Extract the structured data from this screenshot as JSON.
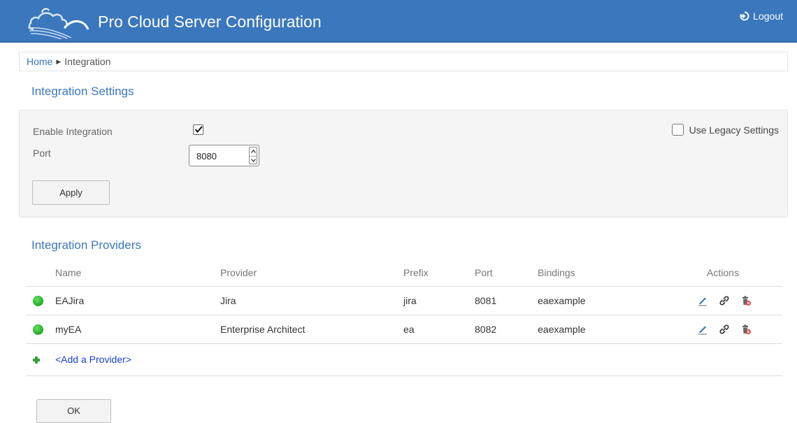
{
  "header": {
    "title": "Pro Cloud Server Configuration",
    "logout_label": "Logout"
  },
  "breadcrumb": {
    "home": "Home",
    "current": "Integration"
  },
  "settings": {
    "title": "Integration Settings",
    "enable_label": "Enable Integration",
    "enable_checked": true,
    "port_label": "Port",
    "port_value": "8080",
    "legacy_label": "Use Legacy Settings",
    "legacy_checked": false,
    "apply_label": "Apply"
  },
  "providers": {
    "title": "Integration Providers",
    "columns": [
      "Name",
      "Provider",
      "Prefix",
      "Port",
      "Bindings",
      "Actions"
    ],
    "rows": [
      {
        "status": "running",
        "name": "EAJira",
        "provider": "Jira",
        "prefix": "jira",
        "port": "8081",
        "bindings": "eaexample"
      },
      {
        "status": "running",
        "name": "myEA",
        "provider": "Enterprise Architect",
        "prefix": "ea",
        "port": "8082",
        "bindings": "eaexample"
      }
    ],
    "add_label": "<Add a Provider>",
    "action_icons": [
      "edit-icon",
      "link-icon",
      "delete-icon"
    ]
  },
  "footer": {
    "ok_label": "OK"
  },
  "colors": {
    "header_bg": "#3a77bd",
    "accent": "#3a77bd",
    "status_ok": "#2db52d",
    "link": "#1a3fd6"
  }
}
